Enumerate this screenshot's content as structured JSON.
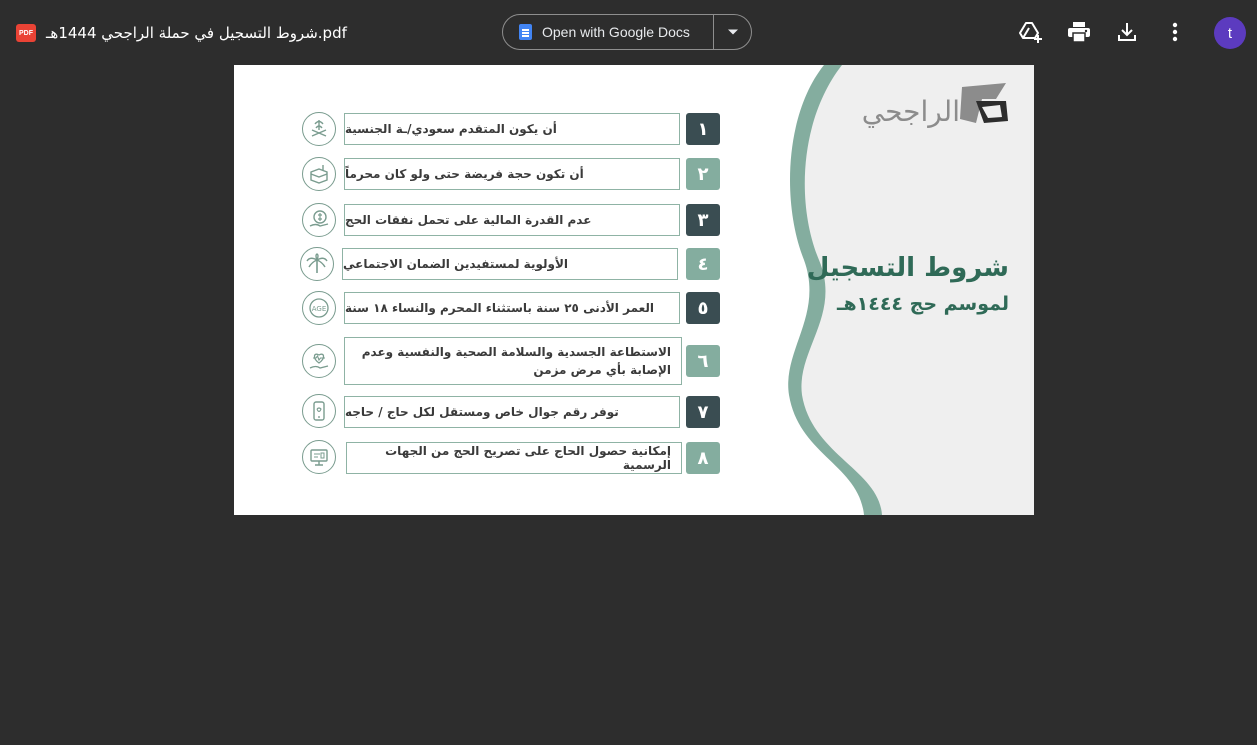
{
  "toolbar": {
    "file_name": "شروط التسجيل في حملة الراجحي 1444هـ.pdf",
    "file_badge": "PDF",
    "open_with_label": "Open with Google Docs",
    "avatar_letter": "t",
    "icons": [
      "add-to-drive-icon",
      "print-icon",
      "download-icon",
      "more-vert-icon",
      "chevron-down-icon"
    ]
  },
  "document": {
    "brand_name": "الراجحي",
    "headline": "شروط التسجيل",
    "subheadline": "لموسم حج ١٤٤٤هـ",
    "colors": {
      "dark_teal": "#3a4d52",
      "sage_green": "#84ad9f",
      "headline_green": "#2f6a57",
      "panel_gray": "#efefef"
    },
    "conditions": [
      {
        "number": "١",
        "text": "أن يكون المتقدم سعودي/ـة الجنسية",
        "icon": "saudi-emblem-icon"
      },
      {
        "number": "٢",
        "text": "أن تكون حجة فريضة حتى ولو كان محرماً",
        "icon": "kaaba-icon"
      },
      {
        "number": "٣",
        "text": "عدم القدرة المالية على تحمل نفقات الحج",
        "icon": "money-hand-icon"
      },
      {
        "number": "٤",
        "text": "الأولوية لمستفيدين الضمان الاجتماعي",
        "icon": "palm-icon"
      },
      {
        "number": "٥",
        "text": "العمر الأدنى ٢٥ سنة باستثناء المحرم والنساء ١٨ سنة",
        "icon": "age-icon"
      },
      {
        "number": "٦",
        "text": "الاستطاعة الجسدية والسلامة الصحية والنفسية وعدم الإصابة بأي مرض مزمن",
        "icon": "health-hand-icon"
      },
      {
        "number": "٧",
        "text": "توفر رقم جوال خاص ومستقل لكل حاج / حاجه",
        "icon": "mobile-phone-icon"
      },
      {
        "number": "٨",
        "text": "إمكانية حصول الحاج على تصريح الحج من الجهات الرسمية",
        "icon": "permit-computer-icon"
      }
    ]
  }
}
